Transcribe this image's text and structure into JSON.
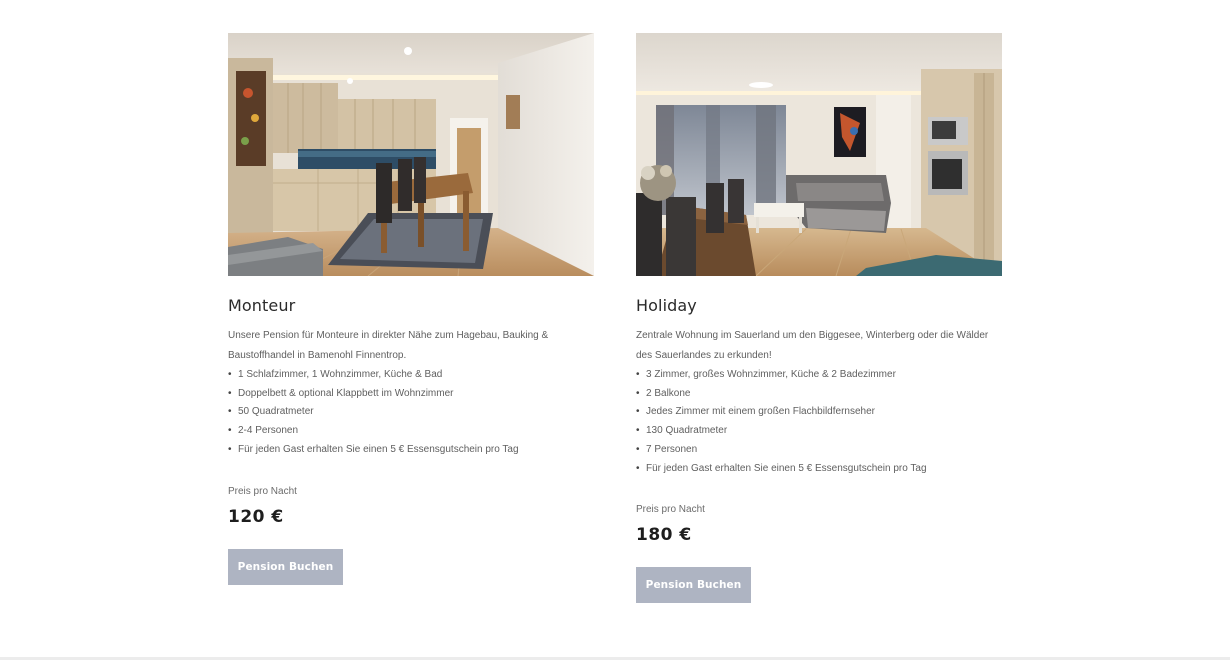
{
  "apartments": [
    {
      "title": "Monteur",
      "image_alt": "Wohnküche mit Esstisch",
      "description": "Unsere Pension für Monteure in direkter Nähe zum Hagebau, Bauking & Baustoffhandel in Bamenohl Finnentrop.",
      "features": [
        "1 Schlafzimmer, 1 Wohnzimmer, Küche & Bad",
        "Doppelbett & optional Klappbett im Wohnzimmer",
        "50 Quadratmeter",
        "2-4 Personen",
        "Für jeden Gast erhalten Sie einen 5 € Essensgutschein pro Tag"
      ],
      "price_label": "Preis pro Nacht",
      "price": "120 €",
      "button_label": "Pension Buchen"
    },
    {
      "title": "Holiday",
      "image_alt": "Wohnzimmer mit Sofa, Esstisch und Küche",
      "description": "Zentrale Wohnung im Sauerland um den Biggesee, Winterberg oder die Wälder des Sauerlandes zu erkunden!",
      "features": [
        "3 Zimmer, großes Wohnzimmer, Küche & 2 Badezimmer",
        "2 Balkone",
        "Jedes Zimmer mit einem großen Flachbildfernseher",
        "130 Quadratmeter",
        "7 Personen",
        "Für jeden Gast erhalten Sie einen 5 € Essensgutschein pro Tag"
      ],
      "price_label": "Preis pro Nacht",
      "price": "180 €",
      "button_label": "Pension Buchen"
    }
  ],
  "colors": {
    "button_bg": "#aeb4c2",
    "button_text": "#ffffff",
    "title_text": "#2a2a2a",
    "body_text": "#5f5f5f"
  }
}
